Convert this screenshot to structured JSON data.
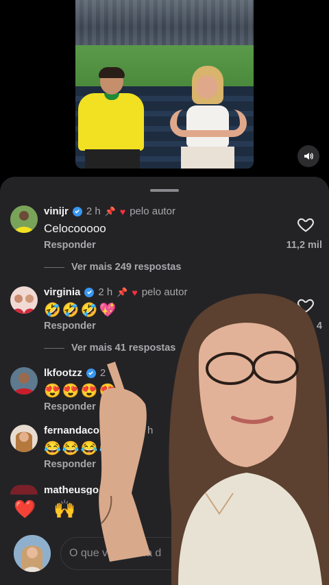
{
  "colors": {
    "background": "#000000",
    "sheet": "#232326",
    "muted": "#a8a8ad",
    "accent_like": "#ff3040",
    "verified": "#3897f0"
  },
  "video": {
    "sound_icon": "speaker-icon"
  },
  "comments": [
    {
      "username": "vinijr",
      "time": "2 h",
      "author_liked": "pelo autor",
      "text": "Celocooooo",
      "reply": "Responder",
      "more_replies": "Ver mais 249 respostas",
      "likes": "11,2 mil"
    },
    {
      "username": "virginia",
      "time": "2 h",
      "author_liked": "pelo autor",
      "emojis": "🤣🤣🤣💖",
      "reply": "Responder",
      "more_replies": "Ver mais 41 respostas",
      "likes": "4"
    },
    {
      "username": "lkfootzz",
      "time": "2",
      "emojis": "😍😍😍😍",
      "reply": "Responder"
    },
    {
      "username": "fernandacolo",
      "username_tail": "bo",
      "time": "2 h",
      "emojis": "😂😂😂😂",
      "reply": "Responder"
    },
    {
      "username": "matheusgo"
    }
  ],
  "quick_reactions": [
    "❤️",
    "🙌"
  ],
  "composer": {
    "placeholder": "O que você acha d"
  }
}
